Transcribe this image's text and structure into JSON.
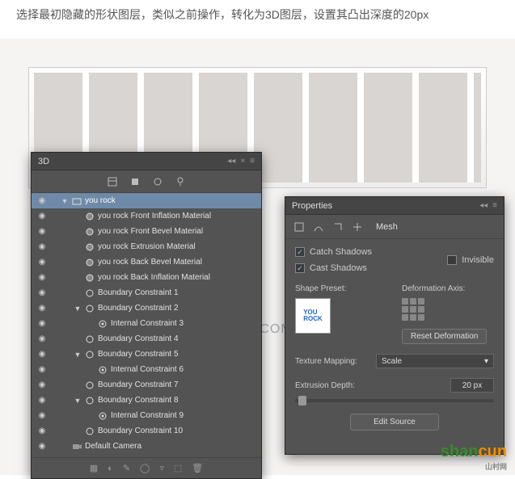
{
  "caption": "选择最初隐藏的形状图层，类似之前操作，转化为3D图层，设置其凸出深度的20px",
  "watermark": "三联网 3LIAN.COM",
  "logo": {
    "part1": "shan",
    "part2": "cun",
    "sub": "山村网"
  },
  "panel3d": {
    "title": "3D",
    "items": [
      {
        "indent": 0,
        "twisty": "▼",
        "icon": "scene",
        "label": "you rock",
        "sel": true,
        "eye": true
      },
      {
        "indent": 1,
        "twisty": "",
        "icon": "mat",
        "label": "you rock Front Inflation Material",
        "eye": true
      },
      {
        "indent": 1,
        "twisty": "",
        "icon": "mat",
        "label": "you rock Front Bevel Material",
        "eye": true
      },
      {
        "indent": 1,
        "twisty": "",
        "icon": "mat",
        "label": "you rock Extrusion Material",
        "eye": true
      },
      {
        "indent": 1,
        "twisty": "",
        "icon": "mat",
        "label": "you rock Back Bevel Material",
        "eye": true
      },
      {
        "indent": 1,
        "twisty": "",
        "icon": "mat",
        "label": "you rock Back Inflation Material",
        "eye": true
      },
      {
        "indent": 1,
        "twisty": "",
        "icon": "constraint",
        "label": "Boundary Constraint 1",
        "eye": true
      },
      {
        "indent": 1,
        "twisty": "▼",
        "icon": "constraint",
        "label": "Boundary Constraint 2",
        "eye": true
      },
      {
        "indent": 2,
        "twisty": "",
        "icon": "internal",
        "label": "Internal Constraint 3",
        "eye": true
      },
      {
        "indent": 1,
        "twisty": "",
        "icon": "constraint",
        "label": "Boundary Constraint 4",
        "eye": true
      },
      {
        "indent": 1,
        "twisty": "▼",
        "icon": "constraint",
        "label": "Boundary Constraint 5",
        "eye": true
      },
      {
        "indent": 2,
        "twisty": "",
        "icon": "internal",
        "label": "Internal Constraint 6",
        "eye": true
      },
      {
        "indent": 1,
        "twisty": "",
        "icon": "constraint",
        "label": "Boundary Constraint 7",
        "eye": true
      },
      {
        "indent": 1,
        "twisty": "▼",
        "icon": "constraint",
        "label": "Boundary Constraint 8",
        "eye": true
      },
      {
        "indent": 2,
        "twisty": "",
        "icon": "internal",
        "label": "Internal Constraint 9",
        "eye": true
      },
      {
        "indent": 1,
        "twisty": "",
        "icon": "constraint",
        "label": "Boundary Constraint 10",
        "eye": true
      },
      {
        "indent": 0,
        "twisty": "",
        "icon": "camera",
        "label": "Default Camera",
        "eye": true
      }
    ]
  },
  "props": {
    "title": "Properties",
    "meshLabel": "Mesh",
    "catchShadows": {
      "label": "Catch Shadows",
      "checked": true
    },
    "castShadows": {
      "label": "Cast Shadows",
      "checked": true
    },
    "invisible": {
      "label": "Invisible",
      "checked": false
    },
    "shapePreset": "Shape Preset:",
    "deformAxis": "Deformation Axis:",
    "resetDeform": "Reset Deformation",
    "textureMapping": {
      "label": "Texture Mapping:",
      "value": "Scale"
    },
    "extrusionDepth": {
      "label": "Extrusion Depth:",
      "value": "20 px"
    },
    "editSource": "Edit Source"
  }
}
